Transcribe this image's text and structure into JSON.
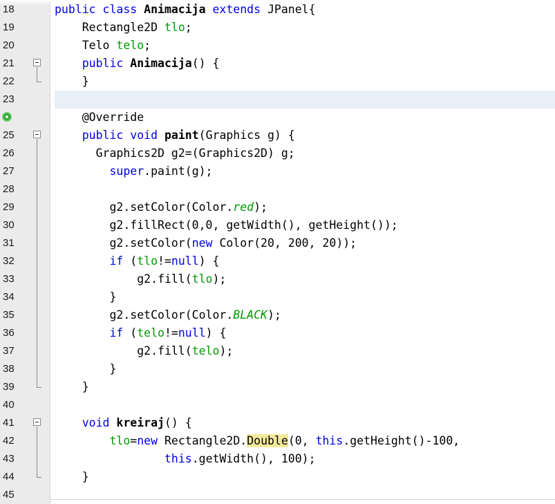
{
  "editor": {
    "language": "java",
    "current_line": "23",
    "lines": [
      {
        "num": "18",
        "tokens": [
          [
            "public class ",
            "k"
          ],
          [
            "Animacija ",
            "b"
          ],
          [
            "extends ",
            "k"
          ],
          [
            "JPanel{",
            ""
          ]
        ]
      },
      {
        "num": "19",
        "tokens": [
          [
            "    Rectangle2D ",
            ""
          ],
          [
            "tlo",
            "f"
          ],
          [
            ";",
            ""
          ]
        ]
      },
      {
        "num": "20",
        "tokens": [
          [
            "    Telo ",
            ""
          ],
          [
            "telo",
            "f"
          ],
          [
            ";",
            ""
          ]
        ]
      },
      {
        "num": "21",
        "fold": "start",
        "tokens": [
          [
            "    ",
            ""
          ],
          [
            "public ",
            "k"
          ],
          [
            "Animacija",
            "b"
          ],
          [
            "() {",
            ""
          ]
        ]
      },
      {
        "num": "22",
        "fold": "end",
        "tokens": [
          [
            "    }",
            ""
          ]
        ]
      },
      {
        "num": "23",
        "tokens": [
          [
            "",
            ""
          ]
        ]
      },
      {
        "num": "",
        "marker": "override-icon",
        "tokens": [
          [
            "    @Override",
            "an"
          ]
        ]
      },
      {
        "num": "25",
        "fold": "start",
        "tokens": [
          [
            "    ",
            ""
          ],
          [
            "public void ",
            "k"
          ],
          [
            "paint",
            "b"
          ],
          [
            "(Graphics g) {",
            ""
          ]
        ]
      },
      {
        "num": "26",
        "tokens": [
          [
            "      Graphics2D g2=(Graphics2D) g;",
            ""
          ]
        ]
      },
      {
        "num": "27",
        "tokens": [
          [
            "        ",
            ""
          ],
          [
            "super",
            "k"
          ],
          [
            ".paint(g);",
            ""
          ]
        ]
      },
      {
        "num": "28",
        "tokens": [
          [
            "",
            ""
          ]
        ]
      },
      {
        "num": "29",
        "tokens": [
          [
            "        g2.setColor(Color.",
            ""
          ],
          [
            "red",
            "fi"
          ],
          [
            ");",
            ""
          ]
        ]
      },
      {
        "num": "30",
        "tokens": [
          [
            "        g2.fillRect(0,0, getWidth(), getHeight());",
            ""
          ]
        ]
      },
      {
        "num": "31",
        "tokens": [
          [
            "        g2.setColor(",
            ""
          ],
          [
            "new ",
            "k"
          ],
          [
            "Color(20, 200, 20));",
            ""
          ]
        ]
      },
      {
        "num": "32",
        "tokens": [
          [
            "        ",
            ""
          ],
          [
            "if ",
            "k"
          ],
          [
            "(",
            ""
          ],
          [
            "tlo",
            "f"
          ],
          [
            "!=",
            ""
          ],
          [
            "null",
            "k"
          ],
          [
            ") {",
            ""
          ]
        ]
      },
      {
        "num": "33",
        "tokens": [
          [
            "            g2.fill(",
            ""
          ],
          [
            "tlo",
            "f"
          ],
          [
            ");",
            ""
          ]
        ]
      },
      {
        "num": "34",
        "tokens": [
          [
            "        }",
            ""
          ]
        ]
      },
      {
        "num": "35",
        "tokens": [
          [
            "        g2.setColor(Color.",
            ""
          ],
          [
            "BLACK",
            "fi"
          ],
          [
            ");",
            ""
          ]
        ]
      },
      {
        "num": "36",
        "tokens": [
          [
            "        ",
            ""
          ],
          [
            "if ",
            "k"
          ],
          [
            "(",
            ""
          ],
          [
            "telo",
            "f"
          ],
          [
            "!=",
            ""
          ],
          [
            "null",
            "k"
          ],
          [
            ") {",
            ""
          ]
        ]
      },
      {
        "num": "37",
        "tokens": [
          [
            "            g2.fill(",
            ""
          ],
          [
            "telo",
            "f"
          ],
          [
            ");",
            ""
          ]
        ]
      },
      {
        "num": "38",
        "tokens": [
          [
            "        }",
            ""
          ]
        ]
      },
      {
        "num": "39",
        "fold": "end",
        "tokens": [
          [
            "    }",
            ""
          ]
        ]
      },
      {
        "num": "40",
        "tokens": [
          [
            "",
            ""
          ]
        ]
      },
      {
        "num": "41",
        "fold": "start",
        "tokens": [
          [
            "    ",
            ""
          ],
          [
            "void ",
            "k"
          ],
          [
            "kreiraj",
            "b"
          ],
          [
            "() {",
            ""
          ]
        ]
      },
      {
        "num": "42",
        "tokens": [
          [
            "        ",
            ""
          ],
          [
            "tlo",
            "f"
          ],
          [
            "=",
            ""
          ],
          [
            "new ",
            "k"
          ],
          [
            "Rectangle2D.",
            ""
          ],
          [
            "Double",
            "hl"
          ],
          [
            "(0, ",
            ""
          ],
          [
            "this",
            "k"
          ],
          [
            ".getHeight()-100,",
            ""
          ]
        ]
      },
      {
        "num": "43",
        "tokens": [
          [
            "                ",
            ""
          ],
          [
            "this",
            "k"
          ],
          [
            ".getWidth(), 100);",
            ""
          ]
        ]
      },
      {
        "num": "44",
        "fold": "end",
        "tokens": [
          [
            "    }",
            ""
          ]
        ]
      },
      {
        "num": "45",
        "tokens": [
          [
            "",
            ""
          ]
        ]
      }
    ]
  },
  "colors": {
    "keyword": "#0000e6",
    "field": "#009900",
    "gutter": "#ebebeb",
    "current_line": "#e9eff8",
    "highlight": "#f3e99a"
  }
}
